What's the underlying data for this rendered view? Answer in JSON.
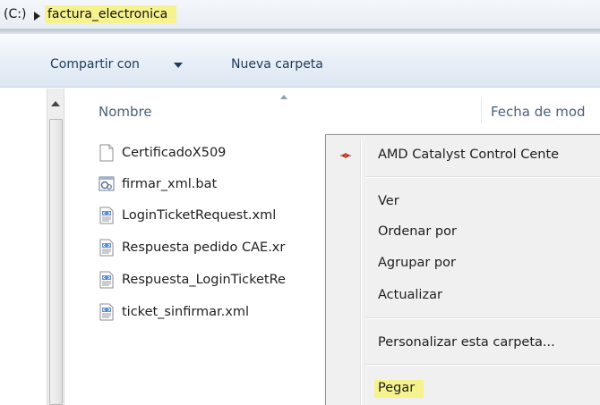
{
  "address": {
    "drive": "(C:)",
    "segment": "factura_electronica"
  },
  "toolbar": {
    "share_label": "Compartir con",
    "new_folder_label": "Nueva carpeta"
  },
  "columns": {
    "name": "Nombre",
    "date": "Fecha de mod"
  },
  "files": [
    {
      "name": "CertificadoX509",
      "icon": "blank-file-icon"
    },
    {
      "name": "firmar_xml.bat",
      "icon": "batch-file-icon"
    },
    {
      "name": "LoginTicketRequest.xml",
      "icon": "xml-file-icon"
    },
    {
      "name": "Respuesta pedido CAE.xr",
      "icon": "xml-file-icon"
    },
    {
      "name": "Respuesta_LoginTicketRe",
      "icon": "xml-file-icon"
    },
    {
      "name": "ticket_sinfirmar.xml",
      "icon": "xml-file-icon"
    }
  ],
  "context_menu": {
    "items": [
      {
        "label": "AMD Catalyst Control Cente",
        "icon": "amd-icon"
      },
      {
        "label": "Ver"
      },
      {
        "label": "Ordenar por"
      },
      {
        "label": "Agrupar por"
      },
      {
        "label": "Actualizar"
      },
      {
        "label": "Personalizar esta carpeta..."
      },
      {
        "label": "Pegar"
      }
    ]
  },
  "colors": {
    "highlight": "#f6f38f",
    "menu_bg": "#f0f0f0",
    "header_text": "#4c607a",
    "toolbar_text": "#1e3a5a"
  }
}
